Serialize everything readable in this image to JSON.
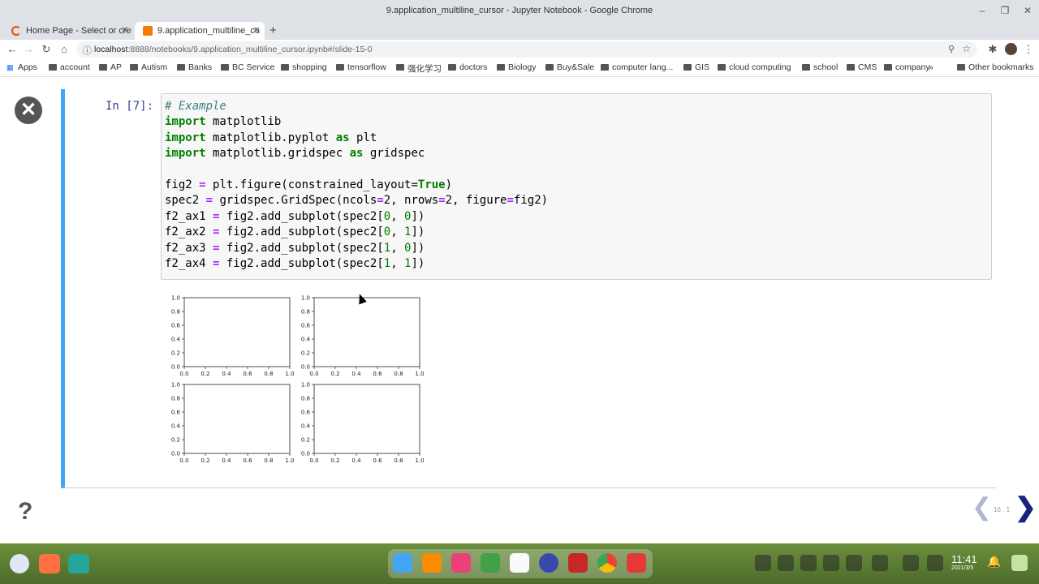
{
  "window": {
    "title": "9.application_multiline_cursor - Jupyter Notebook - Google Chrome"
  },
  "tabs": [
    {
      "label": "Home Page - Select or cre",
      "active": false
    },
    {
      "label": "9.application_multiline_cu",
      "active": true
    }
  ],
  "address": {
    "host": "localhost",
    "rest": ":8888/notebooks/9.application_multiline_cursor.ipynb#/slide-15-0"
  },
  "bookmarks": [
    "Apps",
    "account",
    "AP",
    "Autism",
    "Banks",
    "BC Service",
    "shopping",
    "tensorflow",
    "强化学习",
    "doctors",
    "Biology",
    "Buy&Sale",
    "computer lang...",
    "GIS",
    "cloud computing",
    "school",
    "CMS",
    "company",
    "»",
    "Other bookmarks"
  ],
  "cell": {
    "prompt": "In [7]:",
    "code_lines": [
      "# Example",
      "import matplotlib",
      "import matplotlib.pyplot as plt",
      "import matplotlib.gridspec as gridspec",
      "",
      "fig2 = plt.figure(constrained_layout=True)",
      "spec2 = gridspec.GridSpec(ncols=2, nrows=2, figure=fig2)",
      "f2_ax1 = fig2.add_subplot(spec2[0, 0])",
      "f2_ax2 = fig2.add_subplot(spec2[0, 1])",
      "f2_ax3 = fig2.add_subplot(spec2[1, 0])",
      "f2_ax4 = fig2.add_subplot(spec2[1, 1])"
    ]
  },
  "slides": {
    "counter": "16 . 1"
  },
  "taskbar": {
    "time": "11:41",
    "date": "2021/3/5"
  },
  "colors": {
    "cell_border": "#42a5f5",
    "prompt": "#303f9f",
    "keyword": "#008000",
    "operator": "#aa22ff",
    "nav_next": "#1a237e"
  },
  "icons": [
    "close-icon",
    "help-icon",
    "prev-slide-icon",
    "next-slide-icon"
  ],
  "chart_data": [
    {
      "type": "scatter",
      "x": [],
      "y": [],
      "xlim": [
        0,
        1
      ],
      "ylim": [
        0,
        1
      ],
      "xticks": [
        "0.0",
        "0.2",
        "0.4",
        "0.6",
        "0.8",
        "1.0"
      ],
      "yticks": [
        "0.0",
        "0.2",
        "0.4",
        "0.6",
        "0.8",
        "1.0"
      ]
    },
    {
      "type": "scatter",
      "x": [],
      "y": [],
      "xlim": [
        0,
        1
      ],
      "ylim": [
        0,
        1
      ],
      "xticks": [
        "0.0",
        "0.2",
        "0.4",
        "0.6",
        "0.8",
        "1.0"
      ],
      "yticks": [
        "0.0",
        "0.2",
        "0.4",
        "0.6",
        "0.8",
        "1.0"
      ]
    },
    {
      "type": "scatter",
      "x": [],
      "y": [],
      "xlim": [
        0,
        1
      ],
      "ylim": [
        0,
        1
      ],
      "xticks": [
        "0.0",
        "0.2",
        "0.4",
        "0.6",
        "0.8",
        "1.0"
      ],
      "yticks": [
        "0.0",
        "0.2",
        "0.4",
        "0.6",
        "0.8",
        "1.0"
      ]
    },
    {
      "type": "scatter",
      "x": [],
      "y": [],
      "xlim": [
        0,
        1
      ],
      "ylim": [
        0,
        1
      ],
      "xticks": [
        "0.0",
        "0.2",
        "0.4",
        "0.6",
        "0.8",
        "1.0"
      ],
      "yticks": [
        "0.0",
        "0.2",
        "0.4",
        "0.6",
        "0.8",
        "1.0"
      ]
    }
  ]
}
